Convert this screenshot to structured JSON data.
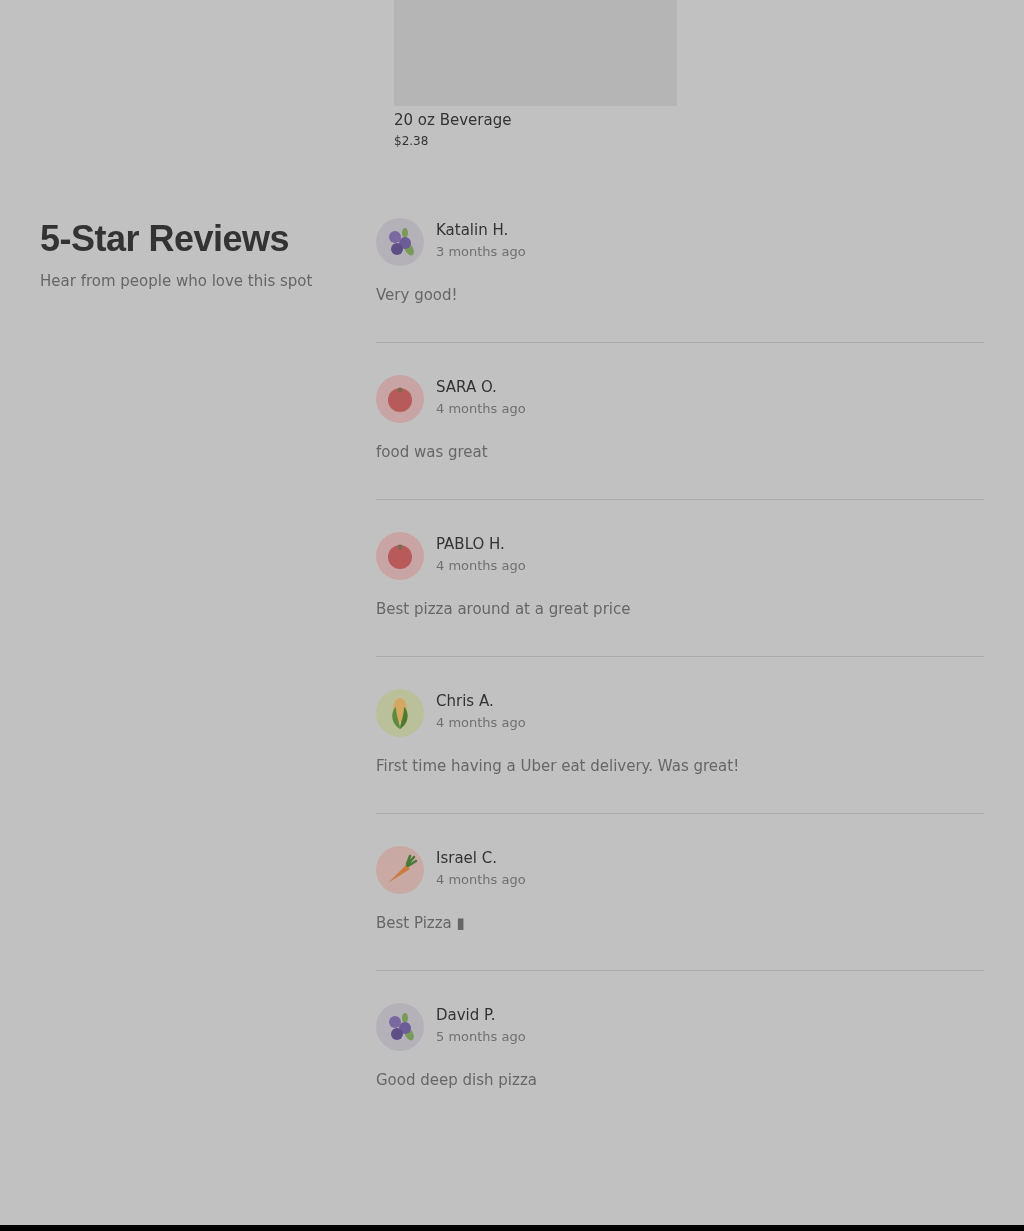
{
  "product": {
    "name": "20 oz Beverage",
    "price": "$2.38"
  },
  "reviews_section": {
    "title": "5-Star Reviews",
    "subtitle": "Hear from people who love this spot",
    "reviews": [
      {
        "name": "Katalin H.",
        "time": "3 months ago",
        "text": "Very good!",
        "avatar": {
          "kind": "blueberry"
        }
      },
      {
        "name": "SARA O.",
        "time": "4 months ago",
        "text": "food was great",
        "avatar": {
          "kind": "tomato"
        }
      },
      {
        "name": "PABLO H.",
        "time": "4 months ago",
        "text": "Best pizza around at a great price",
        "avatar": {
          "kind": "tomato"
        }
      },
      {
        "name": "Chris A.",
        "time": "4 months ago",
        "text": "First time having a Uber eat delivery. Was great!",
        "avatar": {
          "kind": "corn"
        }
      },
      {
        "name": "Israel C.",
        "time": "4 months ago",
        "text": "Best Pizza ▮",
        "avatar": {
          "kind": "carrot"
        }
      },
      {
        "name": "David P.",
        "time": "5 months ago",
        "text": "Good deep dish pizza",
        "avatar": {
          "kind": "blueberry"
        }
      }
    ]
  }
}
